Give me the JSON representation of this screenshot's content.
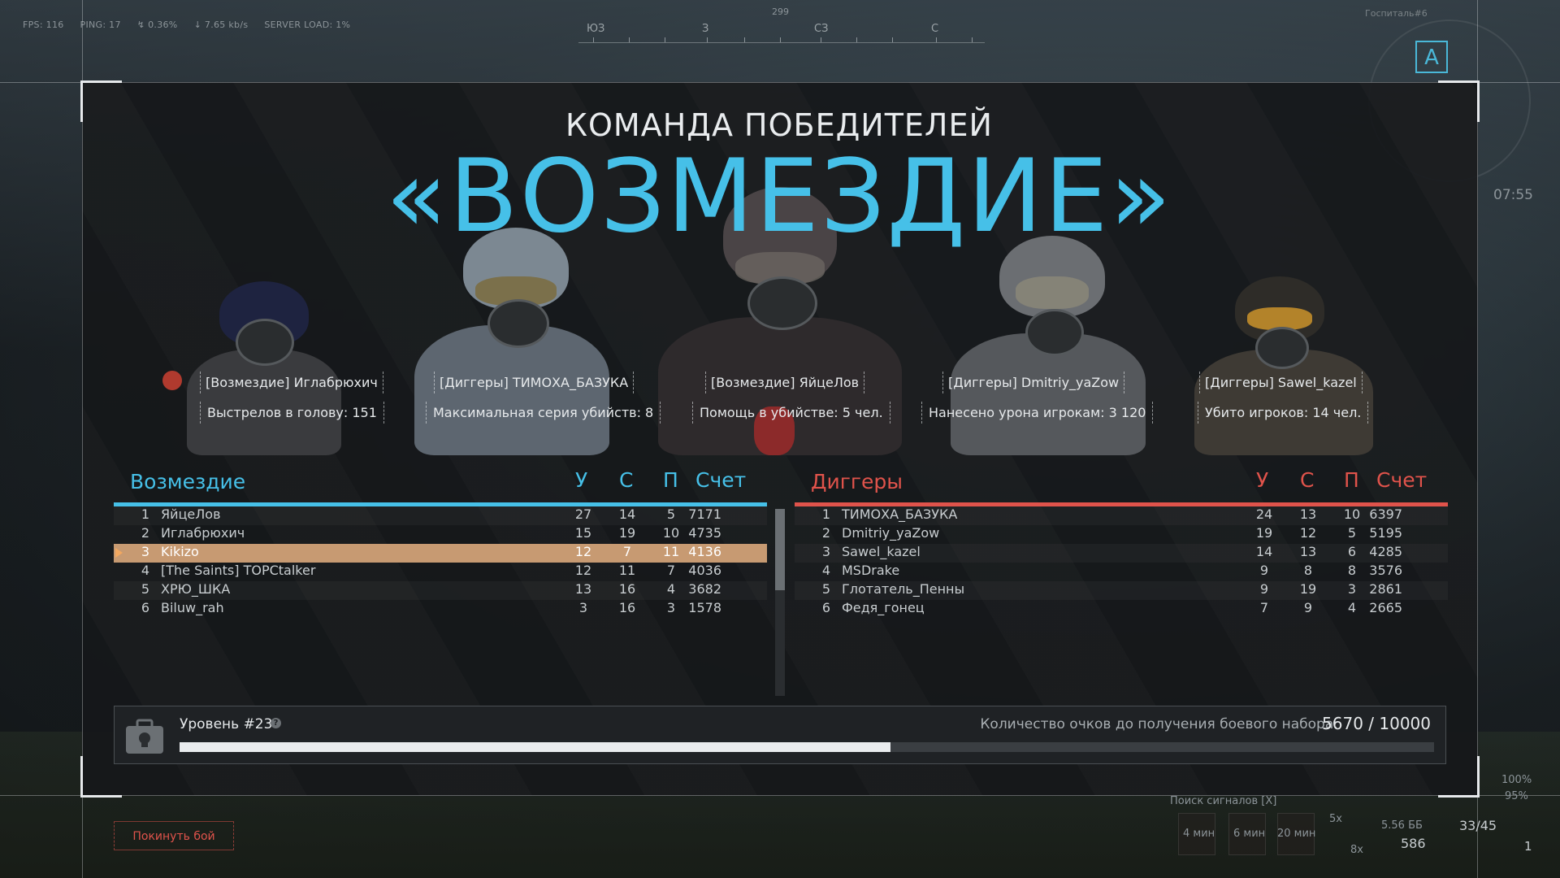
{
  "hud": {
    "fps": "FPS: 116",
    "ping": "PING: 17",
    "loss": "0.36%",
    "traffic": "7.65 kb/s",
    "server_load": "SERVER LOAD: 1%",
    "compass": {
      "bearing": "299",
      "marks": [
        "ЮЗ",
        "З",
        "СЗ",
        "С"
      ]
    },
    "minimap_label": "Госпиталь#6",
    "minimap_marker": "A",
    "time": "07:55"
  },
  "result": {
    "heading": "КОМАНДА ПОБЕДИТЕЛЕЙ",
    "winner": "«ВОЗМЕЗДИЕ»"
  },
  "mvps": [
    {
      "name": "[Возмездие] Иглабрюхич",
      "stat": "Выстрелов в голову: 151"
    },
    {
      "name": "[Диггеры] ТИМОХА_БАЗУКА",
      "stat": "Максимальная серия убийств: 8"
    },
    {
      "name": "[Возмездие] ЯйцеЛов",
      "stat": "Помощь в убийстве: 5 чел."
    },
    {
      "name": "[Диггеры] Dmitriy_yaZow",
      "stat": "Нанесено урона игрокам: 3 120"
    },
    {
      "name": "[Диггеры] Sawel_kazel",
      "stat": "Убито игроков: 14 чел."
    }
  ],
  "columns": {
    "kills": "У",
    "deaths": "С",
    "assists": "П",
    "score": "Счет"
  },
  "teams": [
    {
      "name": "Возмездие",
      "color": "#46c0e8",
      "players": [
        {
          "rank": "1",
          "name": "ЯйцеЛов",
          "kills": "27",
          "deaths": "14",
          "assists": "5",
          "score": "7171"
        },
        {
          "rank": "2",
          "name": "Иглабрюхич",
          "kills": "15",
          "deaths": "19",
          "assists": "10",
          "score": "4735"
        },
        {
          "rank": "3",
          "name": "Kikizo",
          "kills": "12",
          "deaths": "7",
          "assists": "11",
          "score": "4136",
          "is_me": true
        },
        {
          "rank": "4",
          "name": "[The Saints] TOPCtalker",
          "kills": "12",
          "deaths": "11",
          "assists": "7",
          "score": "4036"
        },
        {
          "rank": "5",
          "name": "ХРЮ_ШКА",
          "kills": "13",
          "deaths": "16",
          "assists": "4",
          "score": "3682"
        },
        {
          "rank": "6",
          "name": "Biluw_rah",
          "kills": "3",
          "deaths": "16",
          "assists": "3",
          "score": "1578"
        }
      ]
    },
    {
      "name": "Диггеры",
      "color": "#e0534b",
      "players": [
        {
          "rank": "1",
          "name": "ТИМОХА_БАЗУКА",
          "kills": "24",
          "deaths": "13",
          "assists": "10",
          "score": "6397"
        },
        {
          "rank": "2",
          "name": "Dmitriy_yaZow",
          "kills": "19",
          "deaths": "12",
          "assists": "5",
          "score": "5195"
        },
        {
          "rank": "3",
          "name": "Sawel_kazel",
          "kills": "14",
          "deaths": "13",
          "assists": "6",
          "score": "4285"
        },
        {
          "rank": "4",
          "name": "MSDrake",
          "kills": "9",
          "deaths": "8",
          "assists": "8",
          "score": "3576"
        },
        {
          "rank": "5",
          "name": "Глотатель_Пенны",
          "kills": "9",
          "deaths": "19",
          "assists": "3",
          "score": "2861"
        },
        {
          "rank": "6",
          "name": "Федя_гонец",
          "kills": "7",
          "deaths": "9",
          "assists": "4",
          "score": "2665"
        }
      ]
    }
  ],
  "progress": {
    "level": "Уровень #23",
    "info_icon": "?",
    "label": "Количество очков до получения боевого набора:",
    "value": "5670 / 10000",
    "fraction": 0.567
  },
  "leave_button": "Покинуть бой",
  "bottom_hud": {
    "signal_search": "Поиск сигналов [X]",
    "timers": [
      "4 мин",
      "6 мин",
      "20 мин"
    ],
    "stack_top": "5х",
    "stack_bottom": "8х",
    "ammo_type": "5.56 ББ",
    "ammo_reserve": "586",
    "magazine": "33/45",
    "grenades": "1",
    "health": "100%",
    "stamina": "95%"
  }
}
